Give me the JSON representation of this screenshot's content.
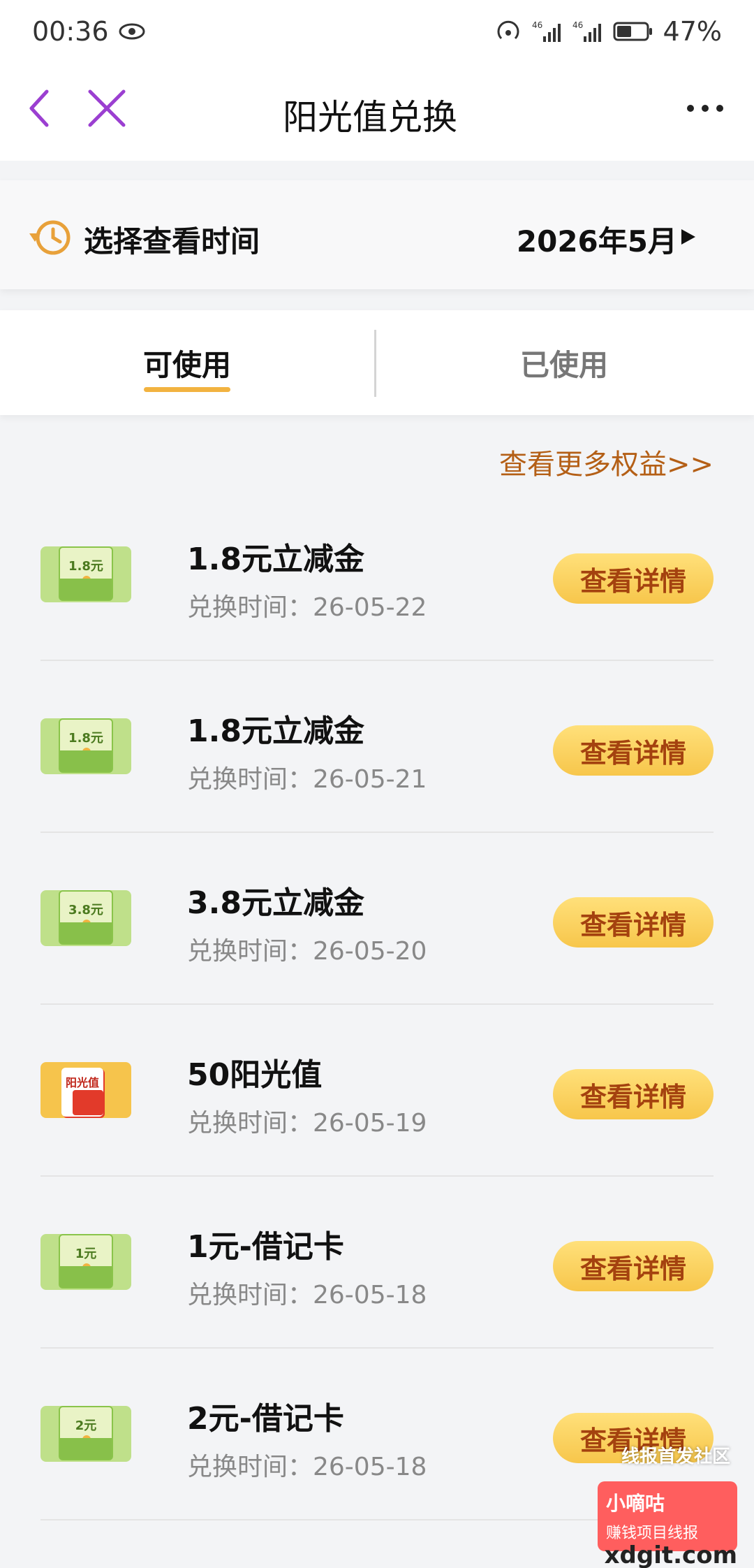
{
  "status_bar": {
    "time": "00:36",
    "network_1": "46",
    "network_2": "46",
    "battery": "47%"
  },
  "nav": {
    "title": "阳光值兑换"
  },
  "time_selector": {
    "label": "选择查看时间",
    "value": "2026年5月"
  },
  "tabs": [
    {
      "label": "可使用",
      "active": true
    },
    {
      "label": "已使用",
      "active": false
    }
  ],
  "more_link": "查看更多权益>>",
  "items": [
    {
      "title": "1.8元立减金",
      "date": "兑换时间：26-05-22",
      "thumb": "green",
      "thumb_amount": "1.8元",
      "button": "查看详情"
    },
    {
      "title": "1.8元立减金",
      "date": "兑换时间：26-05-21",
      "thumb": "green",
      "thumb_amount": "1.8元",
      "button": "查看详情"
    },
    {
      "title": "3.8元立减金",
      "date": "兑换时间：26-05-20",
      "thumb": "green",
      "thumb_amount": "3.8元",
      "button": "查看详情"
    },
    {
      "title": "50阳光值",
      "date": "兑换时间：26-05-19",
      "thumb": "orange",
      "thumb_amount": "阳光值",
      "button": "查看详情"
    },
    {
      "title": "1元-借记卡",
      "date": "兑换时间：26-05-18",
      "thumb": "green",
      "thumb_amount": "1元",
      "button": "查看详情"
    },
    {
      "title": "2元-借记卡",
      "date": "兑换时间：26-05-18",
      "thumb": "green",
      "thumb_amount": "2元",
      "button": "查看详情"
    }
  ],
  "watermark": {
    "line": "线报首发社区",
    "badge_title": "小嘀咕",
    "badge_sub": "赚钱项目线报",
    "domain": "xdgit.com"
  },
  "colors": {
    "accent_purple": "#9b3fd1",
    "tab_underline": "#f2b340",
    "button_text": "#a4420f",
    "link": "#b45f16"
  },
  "icons": {
    "back": "chevron-left-icon",
    "close": "close-icon",
    "more": "more-dots-icon",
    "history": "history-clock-icon",
    "eye": "eye-icon"
  }
}
